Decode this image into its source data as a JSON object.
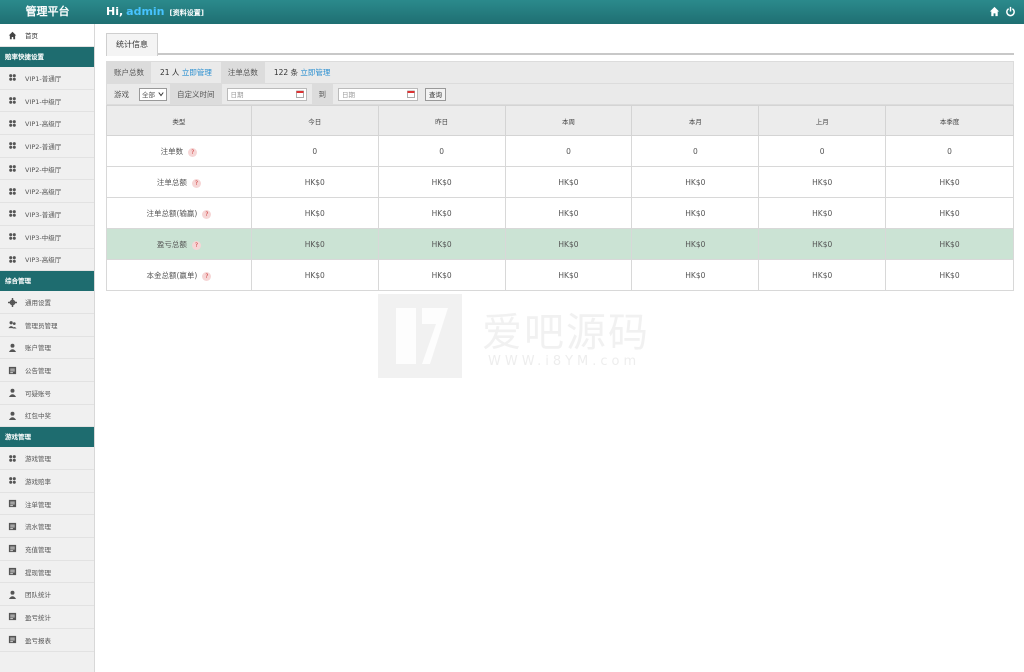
{
  "header": {
    "brand": "管理平台",
    "greeting": "Hi,",
    "username": "admin",
    "profile_link": "[资料设置]"
  },
  "sidebar": {
    "home": "首页",
    "sections": [
      {
        "title": "赔率快捷设置",
        "items": [
          {
            "label": "VIP1-普通厅",
            "icon": "grid-icon"
          },
          {
            "label": "VIP1-中级厅",
            "icon": "grid-icon"
          },
          {
            "label": "VIP1-高级厅",
            "icon": "grid-icon"
          },
          {
            "label": "VIP2-普通厅",
            "icon": "grid-icon"
          },
          {
            "label": "VIP2-中级厅",
            "icon": "grid-icon"
          },
          {
            "label": "VIP2-高级厅",
            "icon": "grid-icon"
          },
          {
            "label": "VIP3-普通厅",
            "icon": "grid-icon"
          },
          {
            "label": "VIP3-中级厅",
            "icon": "grid-icon"
          },
          {
            "label": "VIP3-高级厅",
            "icon": "grid-icon"
          }
        ]
      },
      {
        "title": "综合管理",
        "items": [
          {
            "label": "通用设置",
            "icon": "gear-icon"
          },
          {
            "label": "管理员管理",
            "icon": "users-icon"
          },
          {
            "label": "账户管理",
            "icon": "user-icon"
          },
          {
            "label": "公告管理",
            "icon": "doc-icon"
          },
          {
            "label": "可疑账号",
            "icon": "user-icon"
          },
          {
            "label": "红包中奖",
            "icon": "user-icon"
          }
        ]
      },
      {
        "title": "游戏管理",
        "items": [
          {
            "label": "游戏管理",
            "icon": "grid-icon"
          },
          {
            "label": "游戏赔率",
            "icon": "grid-icon"
          },
          {
            "label": "注单管理",
            "icon": "doc-icon"
          },
          {
            "label": "流水管理",
            "icon": "doc-icon"
          },
          {
            "label": "充值管理",
            "icon": "doc-icon"
          },
          {
            "label": "提现管理",
            "icon": "doc-icon"
          },
          {
            "label": "团队统计",
            "icon": "user-icon"
          },
          {
            "label": "盈亏统计",
            "icon": "doc-icon"
          },
          {
            "label": "盈亏报表",
            "icon": "doc-icon"
          }
        ]
      }
    ]
  },
  "main": {
    "tab": "统计信息",
    "info": {
      "accounts_label": "账户总数",
      "accounts_value": "21 人",
      "accounts_link": "立即管理",
      "bets_label": "注单总数",
      "bets_value": "122 条",
      "bets_link": "立即管理"
    },
    "filter": {
      "game_label": "游戏",
      "game_selected": "全部",
      "custom_time_label": "自定义时间",
      "date_placeholder": "日期",
      "to_label": "到",
      "query_button": "查询"
    },
    "table": {
      "headers": [
        "类型",
        "今日",
        "昨日",
        "本周",
        "本月",
        "上月",
        "本季度"
      ],
      "rows": [
        {
          "type": "注单数",
          "values": [
            "0",
            "0",
            "0",
            "0",
            "0",
            "0"
          ],
          "highlight": false
        },
        {
          "type": "注单总额",
          "values": [
            "HK$0",
            "HK$0",
            "HK$0",
            "HK$0",
            "HK$0",
            "HK$0"
          ],
          "highlight": false
        },
        {
          "type": "注单总额(输赢)",
          "values": [
            "HK$0",
            "HK$0",
            "HK$0",
            "HK$0",
            "HK$0",
            "HK$0"
          ],
          "highlight": false
        },
        {
          "type": "盈亏总额",
          "values": [
            "HK$0",
            "HK$0",
            "HK$0",
            "HK$0",
            "HK$0",
            "HK$0"
          ],
          "highlight": true
        },
        {
          "type": "本金总额(赢单)",
          "values": [
            "HK$0",
            "HK$0",
            "HK$0",
            "HK$0",
            "HK$0",
            "HK$0"
          ],
          "highlight": false
        }
      ],
      "help_glyph": "?"
    }
  },
  "watermark": {
    "title": "爱吧源码",
    "url": "WWW.i8YM.com"
  },
  "colors": {
    "header": "#1f6f72",
    "section": "#1e6c6f",
    "link": "#2a8fd0",
    "highlight_row": "#cbe3d4"
  }
}
